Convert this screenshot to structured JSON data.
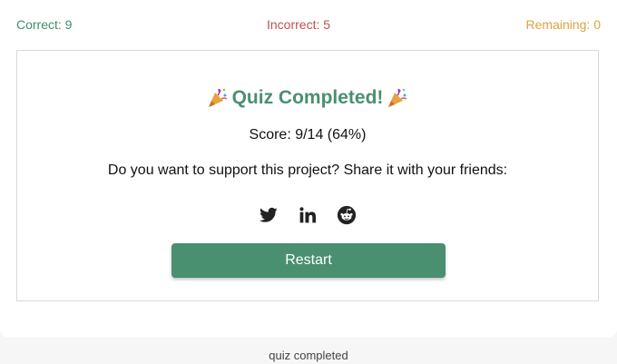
{
  "stats": {
    "correct": "Correct: 9",
    "incorrect": "Incorrect: 5",
    "remaining": "Remaining: 0"
  },
  "result": {
    "title": "Quiz Completed!",
    "title_icon": "party-popper-icon",
    "score": "Score: 9/14 (64%)",
    "support_text": "Do you want to support this project? Share it with your friends:"
  },
  "share": {
    "icons": [
      "twitter-icon",
      "linkedin-icon",
      "reddit-icon"
    ]
  },
  "restart_label": "Restart",
  "caption": "quiz completed",
  "colors": {
    "correct": "#3f8f6a",
    "incorrect": "#c0504d",
    "remaining": "#e0a040",
    "accent": "#4a8f70",
    "icon": "#222222"
  }
}
